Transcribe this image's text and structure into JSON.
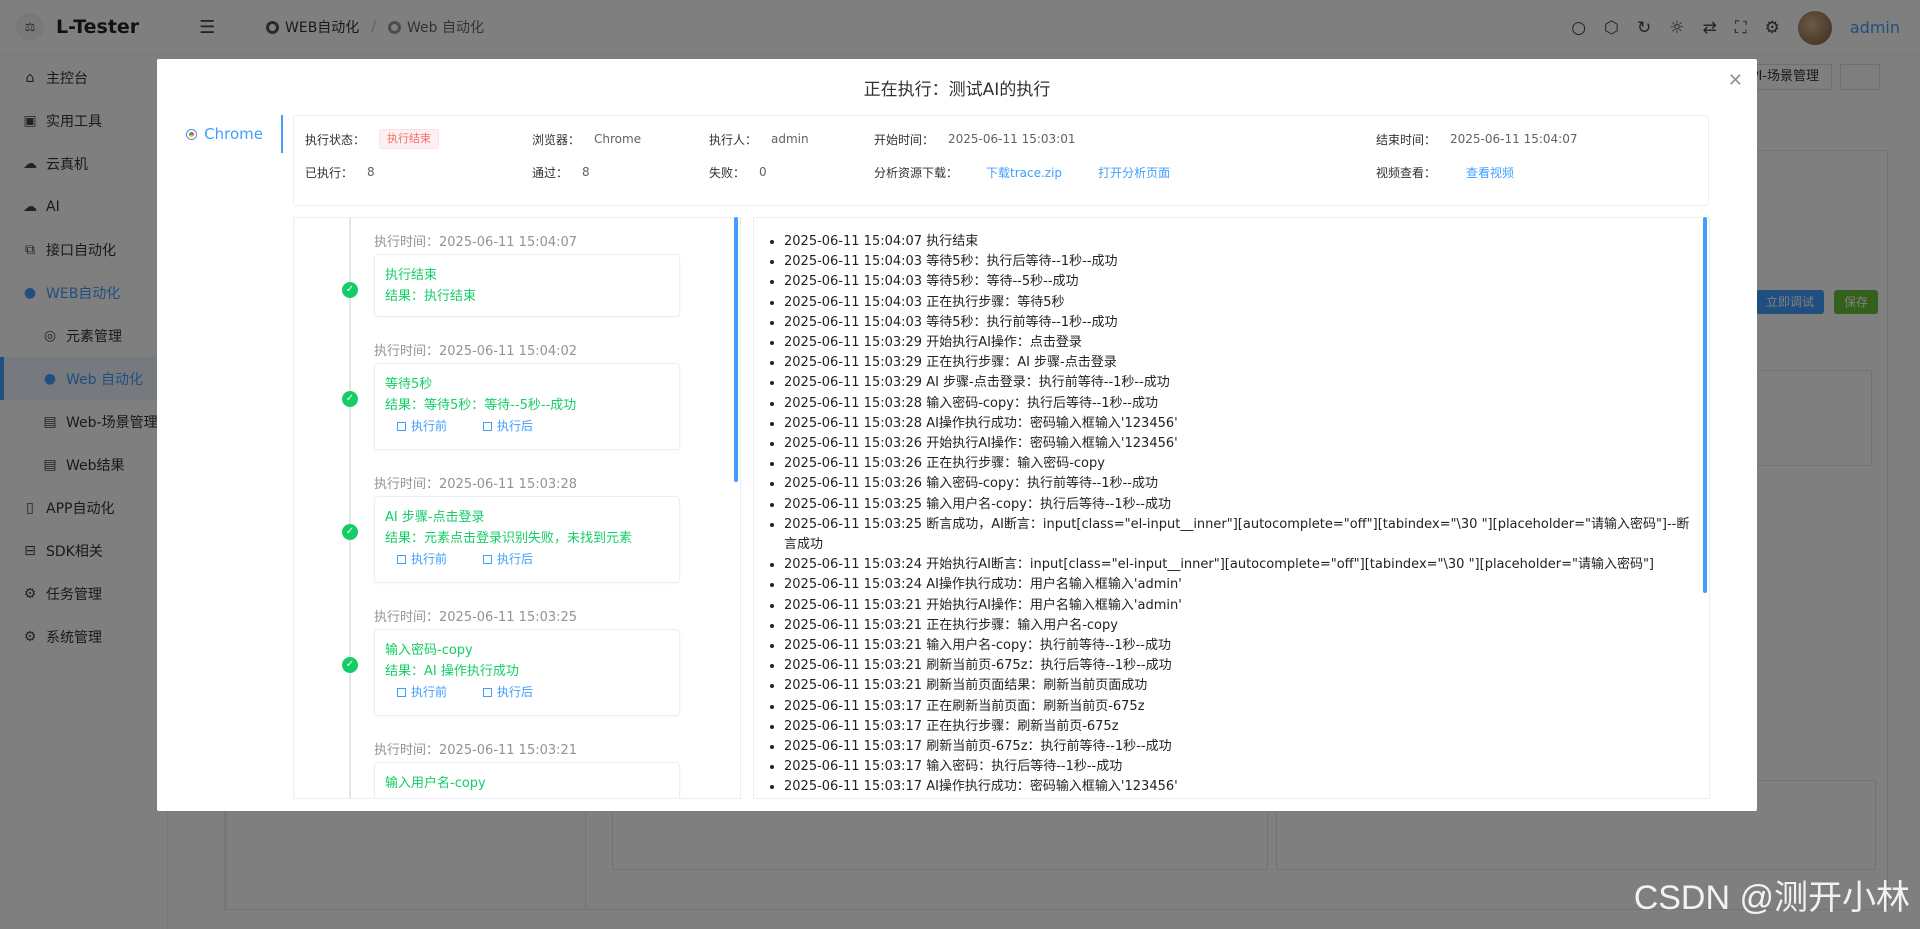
{
  "app": {
    "title": "L-Tester",
    "user": "admin",
    "watermark": "CSDN @测开小林"
  },
  "breadcrumb": [
    "WEB自动化",
    "Web 自动化"
  ],
  "sidebar": {
    "items": [
      {
        "label": "主控台",
        "icon": "home-icon"
      },
      {
        "label": "实用工具",
        "icon": "toolbox-icon"
      },
      {
        "label": "云真机",
        "icon": "cloud-icon"
      },
      {
        "label": "AI",
        "icon": "cloud-icon"
      },
      {
        "label": "接口自动化",
        "icon": "api-icon"
      },
      {
        "label": "WEB自动化",
        "icon": "web-icon"
      },
      {
        "label": "元素管理",
        "icon": "element-icon"
      },
      {
        "label": "Web 自动化",
        "icon": "web-icon"
      },
      {
        "label": "Web-场景管理",
        "icon": "doc-icon"
      },
      {
        "label": "Web结果",
        "icon": "doc-icon"
      },
      {
        "label": "APP自动化",
        "icon": "phone-icon"
      },
      {
        "label": "SDK相关",
        "icon": "sdk-icon"
      },
      {
        "label": "任务管理",
        "icon": "gear-icon"
      },
      {
        "label": "系统管理",
        "icon": "gear-icon"
      }
    ]
  },
  "background": {
    "tab": "API-场景管理",
    "debug_btn": "立即调试",
    "save_btn": "保存"
  },
  "dialog": {
    "title": "正在执行：测试AI的执行",
    "browser_tab": "Chrome",
    "info": {
      "status_label": "执行状态：",
      "status": "执行结束",
      "browser_label": "浏览器：",
      "browser": "Chrome",
      "executor_label": "执行人：",
      "executor": "admin",
      "start_label": "开始时间：",
      "start": "2025-06-11 15:03:01",
      "end_label": "结束时间：",
      "end": "2025-06-11 15:04:07",
      "executed_label": "已执行：",
      "executed": "8",
      "passed_label": "通过：",
      "passed": "8",
      "failed_label": "失败：",
      "failed": "0",
      "download_label": "分析资源下载：",
      "download_link": "下载trace.zip",
      "analysis_link": "打开分析页面",
      "video_label": "视频查看：",
      "video_link": "查看视频"
    },
    "timeline": [
      {
        "time": "执行时间：2025-06-11 15:04:07",
        "title": "执行结束",
        "result": "结果：执行结束",
        "actions": []
      },
      {
        "time": "执行时间：2025-06-11 15:04:02",
        "title": "等待5秒",
        "result": "结果：等待5秒：等待--5秒--成功",
        "actions": [
          "执行前",
          "执行后"
        ]
      },
      {
        "time": "执行时间：2025-06-11 15:03:28",
        "title": "AI 步骤-点击登录",
        "result": "结果：元素点击登录识别失败，未找到元素",
        "actions": [
          "执行前",
          "执行后"
        ]
      },
      {
        "time": "执行时间：2025-06-11 15:03:25",
        "title": "输入密码-copy",
        "result": "结果：AI 操作执行成功",
        "actions": [
          "执行前",
          "执行后"
        ]
      },
      {
        "time": "执行时间：2025-06-11 15:03:21",
        "title": "输入用户名-copy",
        "result": "",
        "actions": []
      }
    ],
    "logs": [
      "2025-06-11 15:04:07 执行结束",
      "2025-06-11 15:04:03 等待5秒：执行后等待--1秒--成功",
      "2025-06-11 15:04:03 等待5秒：等待--5秒--成功",
      "2025-06-11 15:04:03 正在执行步骤：等待5秒",
      "2025-06-11 15:04:03 等待5秒：执行前等待--1秒--成功",
      "2025-06-11 15:03:29 开始执行AI操作：点击登录",
      "2025-06-11 15:03:29 正在执行步骤：AI 步骤-点击登录",
      "2025-06-11 15:03:29 AI 步骤-点击登录：执行前等待--1秒--成功",
      "2025-06-11 15:03:28 输入密码-copy：执行后等待--1秒--成功",
      "2025-06-11 15:03:28 AI操作执行成功：密码输入框输入'123456'",
      "2025-06-11 15:03:26 开始执行AI操作：密码输入框输入'123456'",
      "2025-06-11 15:03:26 正在执行步骤：输入密码-copy",
      "2025-06-11 15:03:26 输入密码-copy：执行前等待--1秒--成功",
      "2025-06-11 15:03:25 输入用户名-copy：执行后等待--1秒--成功",
      "2025-06-11 15:03:25 断言成功，AI断言：input[class=\"el-input__inner\"][autocomplete=\"off\"][tabindex=\"\\30 \"][placeholder=\"请输入密码\"]--断言成功",
      "2025-06-11 15:03:24 开始执行AI断言：input[class=\"el-input__inner\"][autocomplete=\"off\"][tabindex=\"\\30 \"][placeholder=\"请输入密码\"]",
      "2025-06-11 15:03:24 AI操作执行成功：用户名输入框输入'admin'",
      "2025-06-11 15:03:21 开始执行AI操作：用户名输入框输入'admin'",
      "2025-06-11 15:03:21 正在执行步骤：输入用户名-copy",
      "2025-06-11 15:03:21 输入用户名-copy：执行前等待--1秒--成功",
      "2025-06-11 15:03:21 刷新当前页-675z：执行后等待--1秒--成功",
      "2025-06-11 15:03:21 刷新当前页面结果：刷新当前页面成功",
      "2025-06-11 15:03:17 正在刷新当前页面：刷新当前页-675z",
      "2025-06-11 15:03:17 正在执行步骤：刷新当前页-675z",
      "2025-06-11 15:03:17 刷新当前页-675z：执行前等待--1秒--成功",
      "2025-06-11 15:03:17 输入密码：执行后等待--1秒--成功",
      "2025-06-11 15:03:17 AI操作执行成功：密码输入框输入'123456'"
    ]
  }
}
